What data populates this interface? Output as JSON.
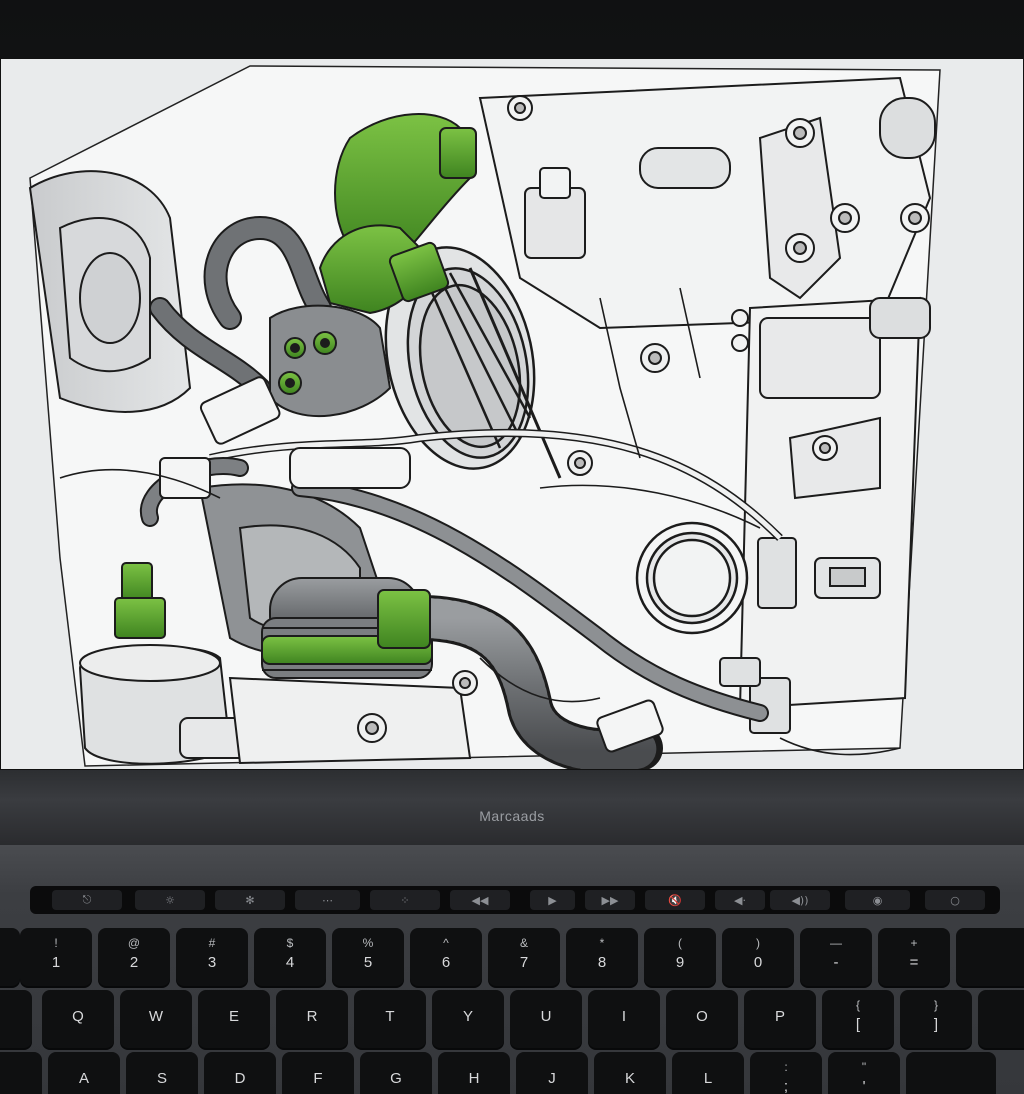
{
  "brand": {
    "label": "Marcaads"
  },
  "touch_bar": [
    {
      "name": "tb-esc",
      "glyph": "⎋"
    },
    {
      "name": "tb-brightness",
      "glyph": "☼"
    },
    {
      "name": "tb-brightness-up",
      "glyph": "✻"
    },
    {
      "name": "tb-keyboard-dim",
      "glyph": "⋯"
    },
    {
      "name": "tb-keyboard-bright",
      "glyph": "⁘"
    },
    {
      "name": "tb-rewind",
      "glyph": "◀◀"
    },
    {
      "name": "tb-play",
      "glyph": "▶"
    },
    {
      "name": "tb-forward",
      "glyph": "▶▶"
    },
    {
      "name": "tb-mute",
      "glyph": "🔇"
    },
    {
      "name": "tb-volume-down",
      "glyph": "◀·"
    },
    {
      "name": "tb-volume-up",
      "glyph": "◀))"
    },
    {
      "name": "tb-siri",
      "glyph": "◉"
    },
    {
      "name": "tb-touchid",
      "glyph": "○"
    }
  ],
  "keys": {
    "row1": [
      {
        "top": "!",
        "bot": "1"
      },
      {
        "top": "@",
        "bot": "2"
      },
      {
        "top": "#",
        "bot": "3"
      },
      {
        "top": "$",
        "bot": "4"
      },
      {
        "top": "%",
        "bot": "5"
      },
      {
        "top": "^",
        "bot": "6"
      },
      {
        "top": "&",
        "bot": "7"
      },
      {
        "top": "*",
        "bot": "8"
      },
      {
        "top": "(",
        "bot": "9"
      },
      {
        "top": ")",
        "bot": "0"
      },
      {
        "top": "—",
        "bot": "-"
      },
      {
        "top": "+",
        "bot": "="
      }
    ],
    "row2": [
      "Q",
      "W",
      "E",
      "R",
      "T",
      "Y",
      "U",
      "I",
      "O",
      "P",
      {
        "top": "{",
        "bot": "["
      },
      {
        "top": "}",
        "bot": "]"
      }
    ],
    "row3": [
      "A",
      "S",
      "D",
      "F",
      "G",
      "H",
      "J",
      "K",
      "L",
      {
        "top": ":",
        "bot": ";"
      },
      {
        "top": "\"",
        "bot": "'"
      }
    ]
  },
  "colors": {
    "highlight_green": "#5fa832",
    "hose_gray": "#7c7f82",
    "line_black": "#1c1c1c",
    "paper": "#eef0f1"
  }
}
